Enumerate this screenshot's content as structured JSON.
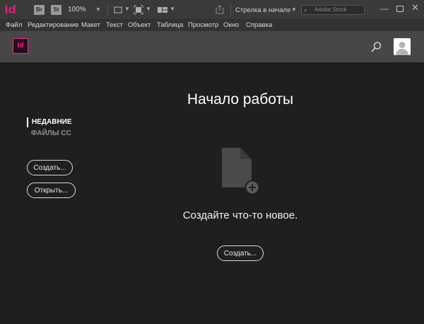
{
  "appbar": {
    "logo": "Id",
    "bridge_label": "Br",
    "stock_label": "St",
    "zoom": "100%",
    "workspace": "Стрелка в начале",
    "stock_search_placeholder": "Adobe Stock"
  },
  "menu": {
    "items": [
      "Файл",
      "Редактирование",
      "Макет",
      "Текст",
      "Объект",
      "Таблица",
      "Просмотр",
      "Окно",
      "Справка"
    ]
  },
  "header": {
    "logo": "Id"
  },
  "sidebar": {
    "recent": "НЕДАВНИЕ",
    "cc_files": "ФАЙЛЫ CC",
    "create_button": "Создать...",
    "open_button": "Открыть..."
  },
  "main": {
    "title": "Начало работы",
    "subtitle": "Создайте что-то новое.",
    "create_button": "Создать..."
  },
  "colors": {
    "accent": "#e0338a",
    "background": "#1f1f1f",
    "header": "#474747"
  }
}
